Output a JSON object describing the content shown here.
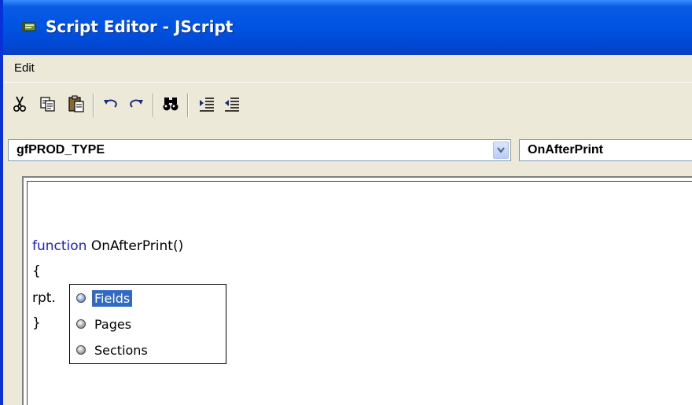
{
  "window": {
    "title": "Script Editor - JScript",
    "title_icon": "script-editor-app-icon",
    "titlebar_color": "#0054e3"
  },
  "menu": {
    "items": [
      {
        "label": "Edit"
      }
    ]
  },
  "toolbar": {
    "buttons": [
      {
        "name": "cut",
        "icon": "scissors-icon"
      },
      {
        "name": "copy",
        "icon": "copy-icon"
      },
      {
        "name": "paste",
        "icon": "clipboard-paste-icon"
      },
      {
        "name": "undo",
        "icon": "undo-arrow-icon"
      },
      {
        "name": "redo",
        "icon": "redo-arrow-icon"
      },
      {
        "name": "find",
        "icon": "binoculars-icon"
      },
      {
        "name": "indent",
        "icon": "indent-icon"
      },
      {
        "name": "outdent",
        "icon": "outdent-icon"
      }
    ]
  },
  "selectors": {
    "object_value": "gfPROD_TYPE",
    "event_value": "OnAfterPrint"
  },
  "editor": {
    "lines": {
      "function_keyword": "function",
      "function_signature": " OnAfterPrint()",
      "open_brace": "{",
      "rpt_prefix": "rpt.",
      "close_brace": "}"
    },
    "keyword_color": "#1c1cdc"
  },
  "autocomplete": {
    "items": [
      {
        "label": "Fields",
        "selected": true
      },
      {
        "label": "Pages",
        "selected": false
      },
      {
        "label": "Sections",
        "selected": false
      }
    ],
    "highlight_color": "#316ac5"
  }
}
